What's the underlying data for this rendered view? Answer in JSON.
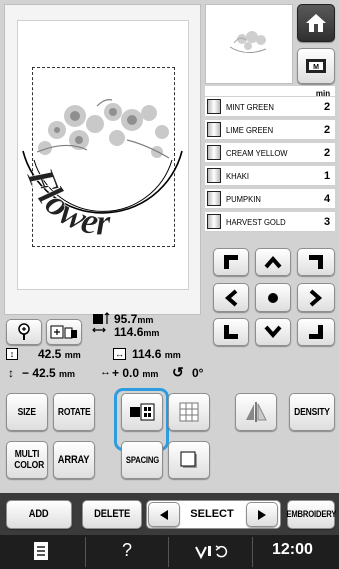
{
  "toolbar": {
    "home_icon": "home-icon",
    "memory_icon": "memory-icon"
  },
  "thread_list": {
    "min_header": "min",
    "threads": [
      {
        "name": "MINT GREEN",
        "minutes": "2"
      },
      {
        "name": "LIME GREEN",
        "minutes": "2"
      },
      {
        "name": "CREAM YELLOW",
        "minutes": "2"
      },
      {
        "name": "KHAKI",
        "minutes": "1"
      },
      {
        "name": "PUMPKIN",
        "minutes": "4"
      },
      {
        "name": "HARVEST GOLD",
        "minutes": "3"
      }
    ]
  },
  "preview": {
    "text": "Flower"
  },
  "dimensions": {
    "height": "95.7",
    "width": "114.6",
    "unit": "mm"
  },
  "position": {
    "row1_left": "42.5",
    "row1_right": "114.6",
    "row2_left": "− 42.5",
    "row2_right": "+ 0.0",
    "rotation": "0°",
    "unit": "mm"
  },
  "buttons": {
    "size": "SIZE",
    "rotate": "ROTATE",
    "density": "DENSITY",
    "multi_color": "MULTI COLOR",
    "array": "ARRAY",
    "spacing": "SPACING",
    "add": "ADD",
    "delete": "DELETE",
    "select": "SELECT",
    "embroidery": "EMBROIDERY"
  },
  "status_bar": {
    "question": "?",
    "time": "12:00"
  },
  "colors": {
    "highlight": "#2e9de0",
    "screen_bg": "#d2d2d2",
    "dark_bar": "#333333"
  }
}
